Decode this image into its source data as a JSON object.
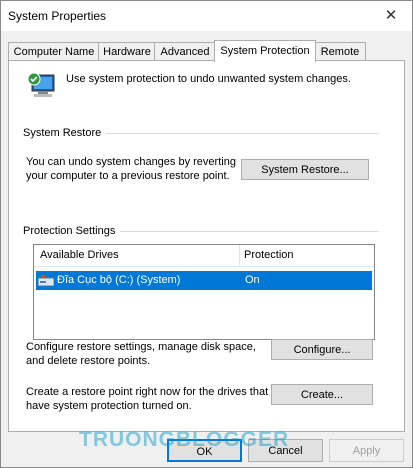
{
  "window": {
    "title": "System Properties",
    "close_glyph": "✕"
  },
  "tabs": [
    {
      "label": "Computer Name"
    },
    {
      "label": "Hardware"
    },
    {
      "label": "Advanced"
    },
    {
      "label": "System Protection",
      "active": true
    },
    {
      "label": "Remote"
    }
  ],
  "intro": {
    "icon": "computer-shield-icon",
    "text": "Use system protection to undo unwanted system changes."
  },
  "system_restore": {
    "heading": "System Restore",
    "description": [
      "You can undo system changes by reverting",
      "your computer to a previous restore point."
    ],
    "button_label": "System Restore..."
  },
  "protection": {
    "heading": "Protection Settings",
    "columns": [
      "Available Drives",
      "Protection"
    ],
    "drives": [
      {
        "name": "Đĩa Cục bộ (C:) (System)",
        "protection": "On",
        "icon": "drive-icon",
        "selected": true
      }
    ],
    "configure_text": [
      "Configure restore settings, manage disk space,",
      "and delete restore points."
    ],
    "configure_label": "Configure...",
    "create_text": [
      "Create a restore point right now for the drives that",
      "have system protection turned on."
    ],
    "create_label": "Create..."
  },
  "footer": {
    "ok_label": "OK",
    "cancel_label": "Cancel",
    "apply_label": "Apply"
  },
  "watermark": "TRUONGBLOGGER",
  "colors": {
    "selection": "#0078d7",
    "button_face": "#e1e1e1",
    "border": "#adadad"
  }
}
